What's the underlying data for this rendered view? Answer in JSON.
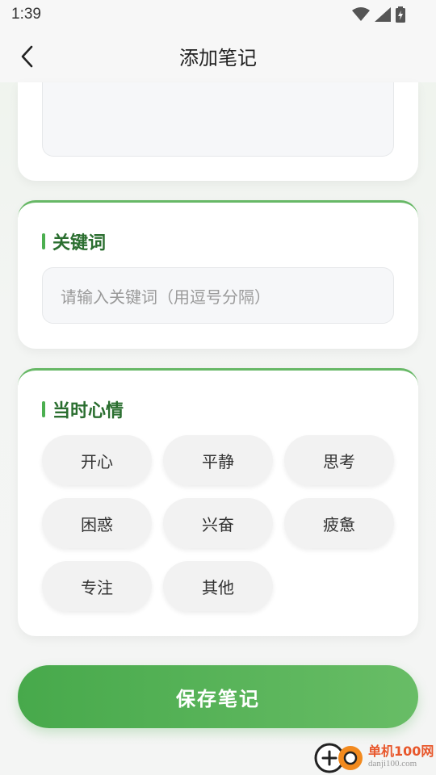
{
  "status_bar": {
    "time": "1:39"
  },
  "header": {
    "title": "添加笔记"
  },
  "keywords": {
    "title": "关键词",
    "placeholder": "请输入关键词（用逗号分隔）"
  },
  "mood": {
    "title": "当时心情",
    "options": [
      "开心",
      "平静",
      "思考",
      "困惑",
      "兴奋",
      "疲惫",
      "专注",
      "其他"
    ]
  },
  "actions": {
    "save_label": "保存笔记"
  },
  "watermark": {
    "name": "单机100网",
    "url": "danji100.com"
  },
  "colors": {
    "accent": "#4caf50",
    "title_green": "#2a6e2f"
  }
}
